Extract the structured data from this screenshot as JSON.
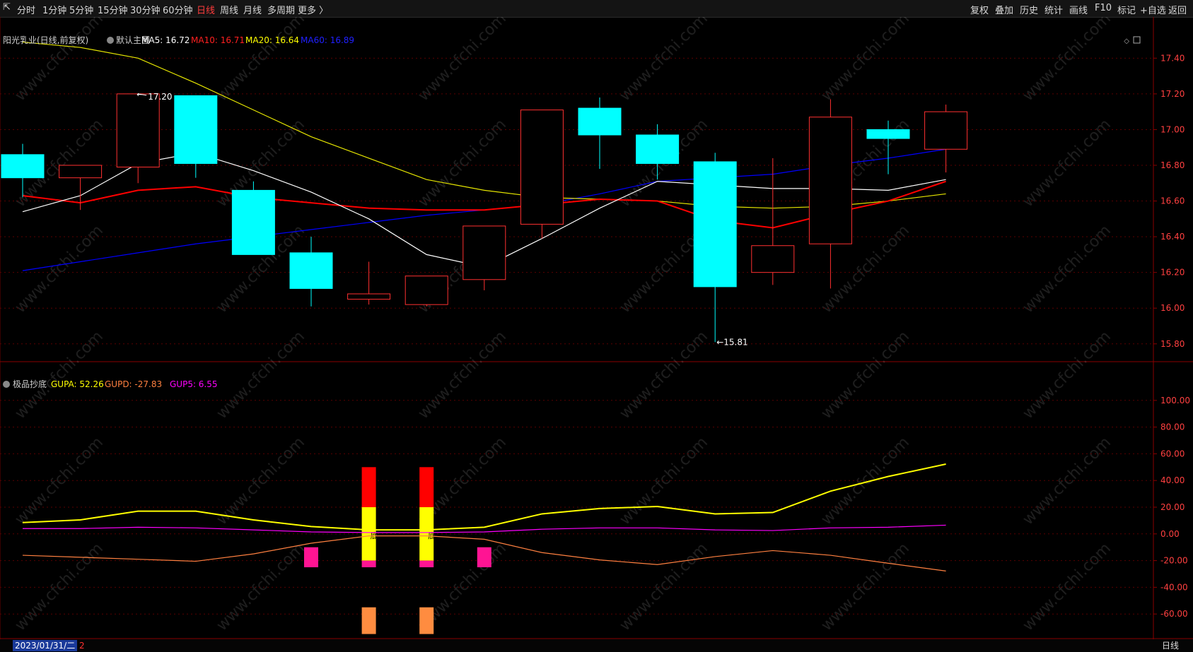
{
  "toolbar": {
    "back_arrow": "⇱",
    "periods": [
      "分时",
      "1分钟",
      "5分钟",
      "15分钟",
      "30分钟",
      "60分钟",
      "日线",
      "周线",
      "月线",
      "多周期",
      "更多 〉"
    ],
    "active_period": "日线",
    "right_tools": [
      "复权",
      "叠加",
      "历史",
      "统计",
      "画线",
      "F10",
      "标记",
      "+自选",
      "返回"
    ]
  },
  "main_panel": {
    "stock_title": "阳光乳业(日线,前复权)",
    "indicator_name": "默认主图",
    "ma_legend": [
      {
        "label": "MA5: 16.72",
        "color": "#ffffff"
      },
      {
        "label": "MA10: 16.71",
        "color": "#ff2020"
      },
      {
        "label": "MA20: 16.64",
        "color": "#ffff00"
      },
      {
        "label": "MA60: 16.89",
        "color": "#2020ff"
      }
    ],
    "price_axis_labels": [
      "17.40",
      "17.20",
      "17.00",
      "16.80",
      "16.60",
      "16.40",
      "16.20",
      "16.00",
      "15.80"
    ],
    "high_marker": "17.20",
    "low_marker": "15.81"
  },
  "sub_panel": {
    "indicator_name": "极品抄底",
    "legend": [
      {
        "label": "GUPA: 52.26",
        "color": "#ffff00"
      },
      {
        "label": "GUPD: -27.83",
        "color": "#ff8040"
      },
      {
        "label": "GUP5: 6.55",
        "color": "#ff00ff"
      }
    ],
    "axis_labels": [
      "100.00",
      "80.00",
      "60.00",
      "40.00",
      "20.00",
      "0.00",
      "-20.00",
      "-40.00",
      "-60.00"
    ],
    "signal_text": "底"
  },
  "watermark": "www.cfchi.com",
  "status_bar": {
    "date": "2023/01/31/二",
    "flag": "2",
    "period": "日线"
  },
  "chart_data": [
    {
      "type": "candlestick",
      "title": "阳光乳业(日线,前复权)",
      "ylim": [
        15.72,
        17.52
      ],
      "colors": {
        "up": "#ff3030",
        "down": "#00ffff",
        "MA5": "#ffffff",
        "MA10": "#ff0000",
        "MA20": "#e6e600",
        "MA60": "#0000ff"
      },
      "candles": [
        {
          "o": 16.86,
          "h": 16.92,
          "l": 16.62,
          "c": 16.73
        },
        {
          "o": 16.73,
          "h": 16.8,
          "l": 16.55,
          "c": 16.8
        },
        {
          "o": 16.79,
          "h": 17.2,
          "l": 16.7,
          "c": 17.2
        },
        {
          "o": 17.19,
          "h": 17.19,
          "l": 16.73,
          "c": 16.81
        },
        {
          "o": 16.66,
          "h": 16.71,
          "l": 16.3,
          "c": 16.3
        },
        {
          "o": 16.31,
          "h": 16.4,
          "l": 16.01,
          "c": 16.11
        },
        {
          "o": 16.05,
          "h": 16.26,
          "l": 16.02,
          "c": 16.08
        },
        {
          "o": 16.02,
          "h": 16.18,
          "l": 16.01,
          "c": 16.18
        },
        {
          "o": 16.16,
          "h": 16.46,
          "l": 16.1,
          "c": 16.46
        },
        {
          "o": 16.47,
          "h": 17.11,
          "l": 16.39,
          "c": 17.11
        },
        {
          "o": 17.12,
          "h": 17.18,
          "l": 16.78,
          "c": 16.97
        },
        {
          "o": 16.97,
          "h": 17.03,
          "l": 16.72,
          "c": 16.81
        },
        {
          "o": 16.82,
          "h": 16.87,
          "l": 15.81,
          "c": 16.12
        },
        {
          "o": 16.2,
          "h": 16.84,
          "l": 16.13,
          "c": 16.35
        },
        {
          "o": 16.36,
          "h": 17.17,
          "l": 16.11,
          "c": 17.07
        },
        {
          "o": 17.0,
          "h": 17.05,
          "l": 16.75,
          "c": 16.95
        },
        {
          "o": 16.89,
          "h": 17.14,
          "l": 16.76,
          "c": 17.1
        }
      ],
      "MA5": [
        16.54,
        16.63,
        16.81,
        16.87,
        16.77,
        16.65,
        16.5,
        16.3,
        16.23,
        16.39,
        16.56,
        16.71,
        16.69,
        16.67,
        16.67,
        16.66,
        16.72
      ],
      "MA10": [
        16.63,
        16.59,
        16.66,
        16.68,
        16.62,
        16.59,
        16.56,
        16.55,
        16.55,
        16.58,
        16.61,
        16.6,
        16.49,
        16.45,
        16.53,
        16.6,
        16.71
      ],
      "MA20": [
        17.49,
        17.46,
        17.4,
        17.26,
        17.11,
        16.96,
        16.84,
        16.72,
        16.66,
        16.62,
        16.61,
        16.6,
        16.57,
        16.56,
        16.57,
        16.6,
        16.64
      ],
      "MA60": [
        16.21,
        16.26,
        16.31,
        16.36,
        16.4,
        16.44,
        16.48,
        16.52,
        16.55,
        16.58,
        16.64,
        16.71,
        16.73,
        16.75,
        16.8,
        16.84,
        16.89
      ]
    },
    {
      "type": "line",
      "title": "极品抄底",
      "ylim": [
        -80,
        120
      ],
      "series": [
        {
          "name": "GUPA",
          "color": "#ffff00",
          "values": [
            8.5,
            10.5,
            17,
            17,
            10.5,
            5.5,
            3,
            3,
            5,
            15,
            19,
            20.5,
            15,
            16,
            32,
            43,
            52.26
          ]
        },
        {
          "name": "GUP5",
          "color": "#ff00ff",
          "values": [
            4,
            4,
            5,
            4.5,
            3,
            1.5,
            1,
            1,
            1.5,
            3.5,
            4.5,
            4.5,
            3,
            2.5,
            4.5,
            5,
            6.55
          ]
        },
        {
          "name": "GUPD",
          "color": "#ff8040",
          "values": [
            -16,
            -17.5,
            -19,
            -20.5,
            -15,
            -7,
            -1.5,
            -1.5,
            -4,
            -14,
            -19.5,
            -23,
            -17,
            -12.5,
            -16,
            -22,
            -27.83
          ]
        }
      ],
      "signal_bars": [
        {
          "index": 6,
          "red_top": 50,
          "red_bottom": 20,
          "yellow_bottom": -20,
          "magenta_bottom": -25,
          "orange_top": -55,
          "orange_bottom": -75
        },
        {
          "index": 7,
          "red_top": 50,
          "red_bottom": 20,
          "yellow_bottom": -20,
          "magenta_bottom": -25,
          "orange_top": -55,
          "orange_bottom": -75
        }
      ],
      "pink_blocks": [
        {
          "index": 5,
          "top": -10,
          "bottom": -25
        },
        {
          "index": 8,
          "top": -10,
          "bottom": -25
        }
      ]
    }
  ]
}
